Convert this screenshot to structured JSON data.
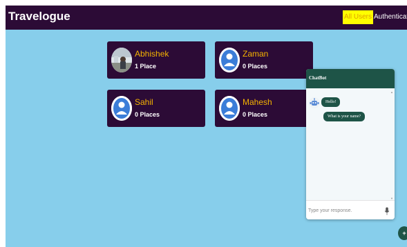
{
  "navbar": {
    "brand": "Travelogue",
    "links": [
      {
        "label": "All Users",
        "active": true
      },
      {
        "label": "Authenticate",
        "active": false
      }
    ]
  },
  "users": [
    {
      "name": "Abhishek",
      "places": "1 Place",
      "avatar": "photo-avatar"
    },
    {
      "name": "Zaman",
      "places": "0 Places",
      "avatar": "default-user-avatar-icon"
    },
    {
      "name": "Sahil",
      "places": "0 Places",
      "avatar": "default-user-avatar-icon"
    },
    {
      "name": "Mahesh",
      "places": "0 Places",
      "avatar": "default-user-avatar-icon"
    }
  ],
  "chatbot": {
    "title": "ChatBot",
    "messages": [
      "Hello!",
      "What is your name?"
    ],
    "input_placeholder": "Type your response.",
    "mic_icon": "microphone-icon",
    "bot_icon": "robot-icon"
  },
  "fab": {
    "label": "+"
  },
  "colors": {
    "background": "#87ceeb",
    "navbar": "#2c0b36",
    "card": "#2c0b36",
    "card_name": "#f5b300",
    "active_link_bg": "#ffff00",
    "chat_accent": "#1e5447"
  }
}
